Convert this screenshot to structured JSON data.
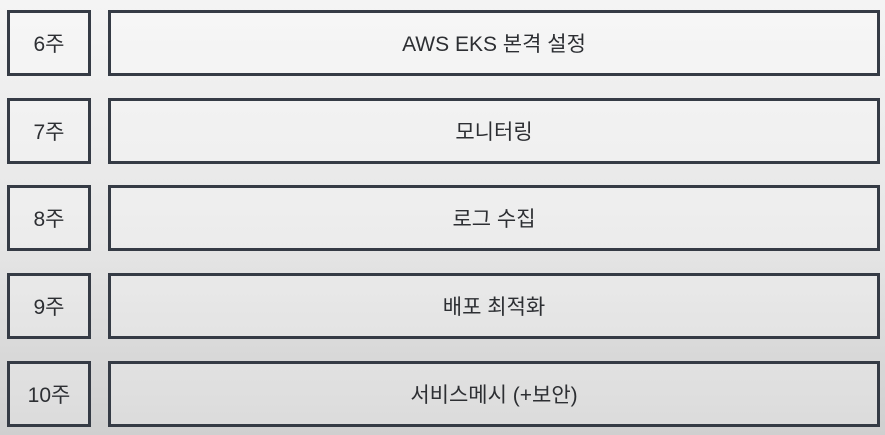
{
  "schedule": [
    {
      "week": "6주",
      "topic": "AWS EKS 본격 설정"
    },
    {
      "week": "7주",
      "topic": "모니터링"
    },
    {
      "week": "8주",
      "topic": "로그 수집"
    },
    {
      "week": "9주",
      "topic": "배포 최적화"
    },
    {
      "week": "10주",
      "topic": "서비스메시 (+보안)"
    }
  ]
}
